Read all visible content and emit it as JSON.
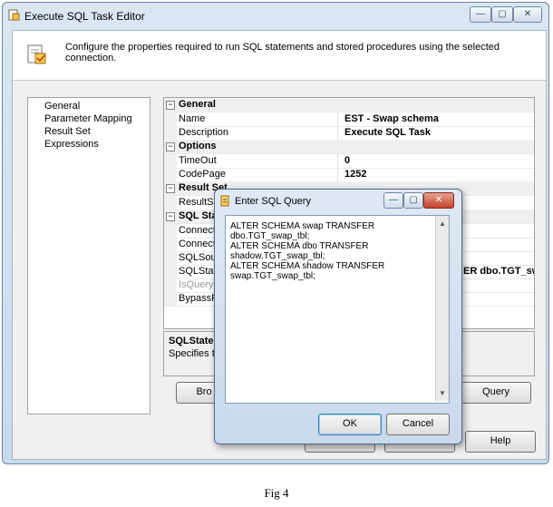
{
  "window": {
    "title": "Execute SQL Task Editor",
    "header_text": "Configure the properties required to run SQL statements and stored procedures using the selected connection.",
    "controls": {
      "minimize": "—",
      "maximize": "▢",
      "close": "✕"
    }
  },
  "nav": {
    "items": [
      {
        "label": "General"
      },
      {
        "label": "Parameter Mapping"
      },
      {
        "label": "Result Set"
      },
      {
        "label": "Expressions"
      }
    ]
  },
  "grid": {
    "general": {
      "label": "General",
      "name_label": "Name",
      "name_value": "EST - Swap schema",
      "desc_label": "Description",
      "desc_value": "Execute SQL Task"
    },
    "options": {
      "label": "Options",
      "timeout_label": "TimeOut",
      "timeout_value": "0",
      "codepage_label": "CodePage",
      "codepage_value": "1252"
    },
    "resultset": {
      "label": "Result Set",
      "resultset_label": "ResultSet"
    },
    "sql": {
      "label": "SQL State",
      "rows": [
        "Connectio",
        "Connectio",
        "SQLSourc",
        "SQLStater",
        "IsQuerySt",
        "BypassPre"
      ],
      "sqlstatement_value": "ER dbo.TGT_swap"
    }
  },
  "description": {
    "title": "SQLStateme",
    "text": "Specifies the"
  },
  "buttons": {
    "browse": "Bro",
    "build_query": "Query",
    "help": "Help"
  },
  "dialog": {
    "title": "Enter SQL Query",
    "sql": "ALTER SCHEMA swap TRANSFER dbo.TGT_swap_tbl;\nALTER SCHEMA dbo TRANSFER shadow.TGT_swap_tbl;\nALTER SCHEMA shadow TRANSFER swap.TGT_swap_tbl;",
    "ok": "OK",
    "cancel": "Cancel"
  },
  "caption": "Fig 4"
}
